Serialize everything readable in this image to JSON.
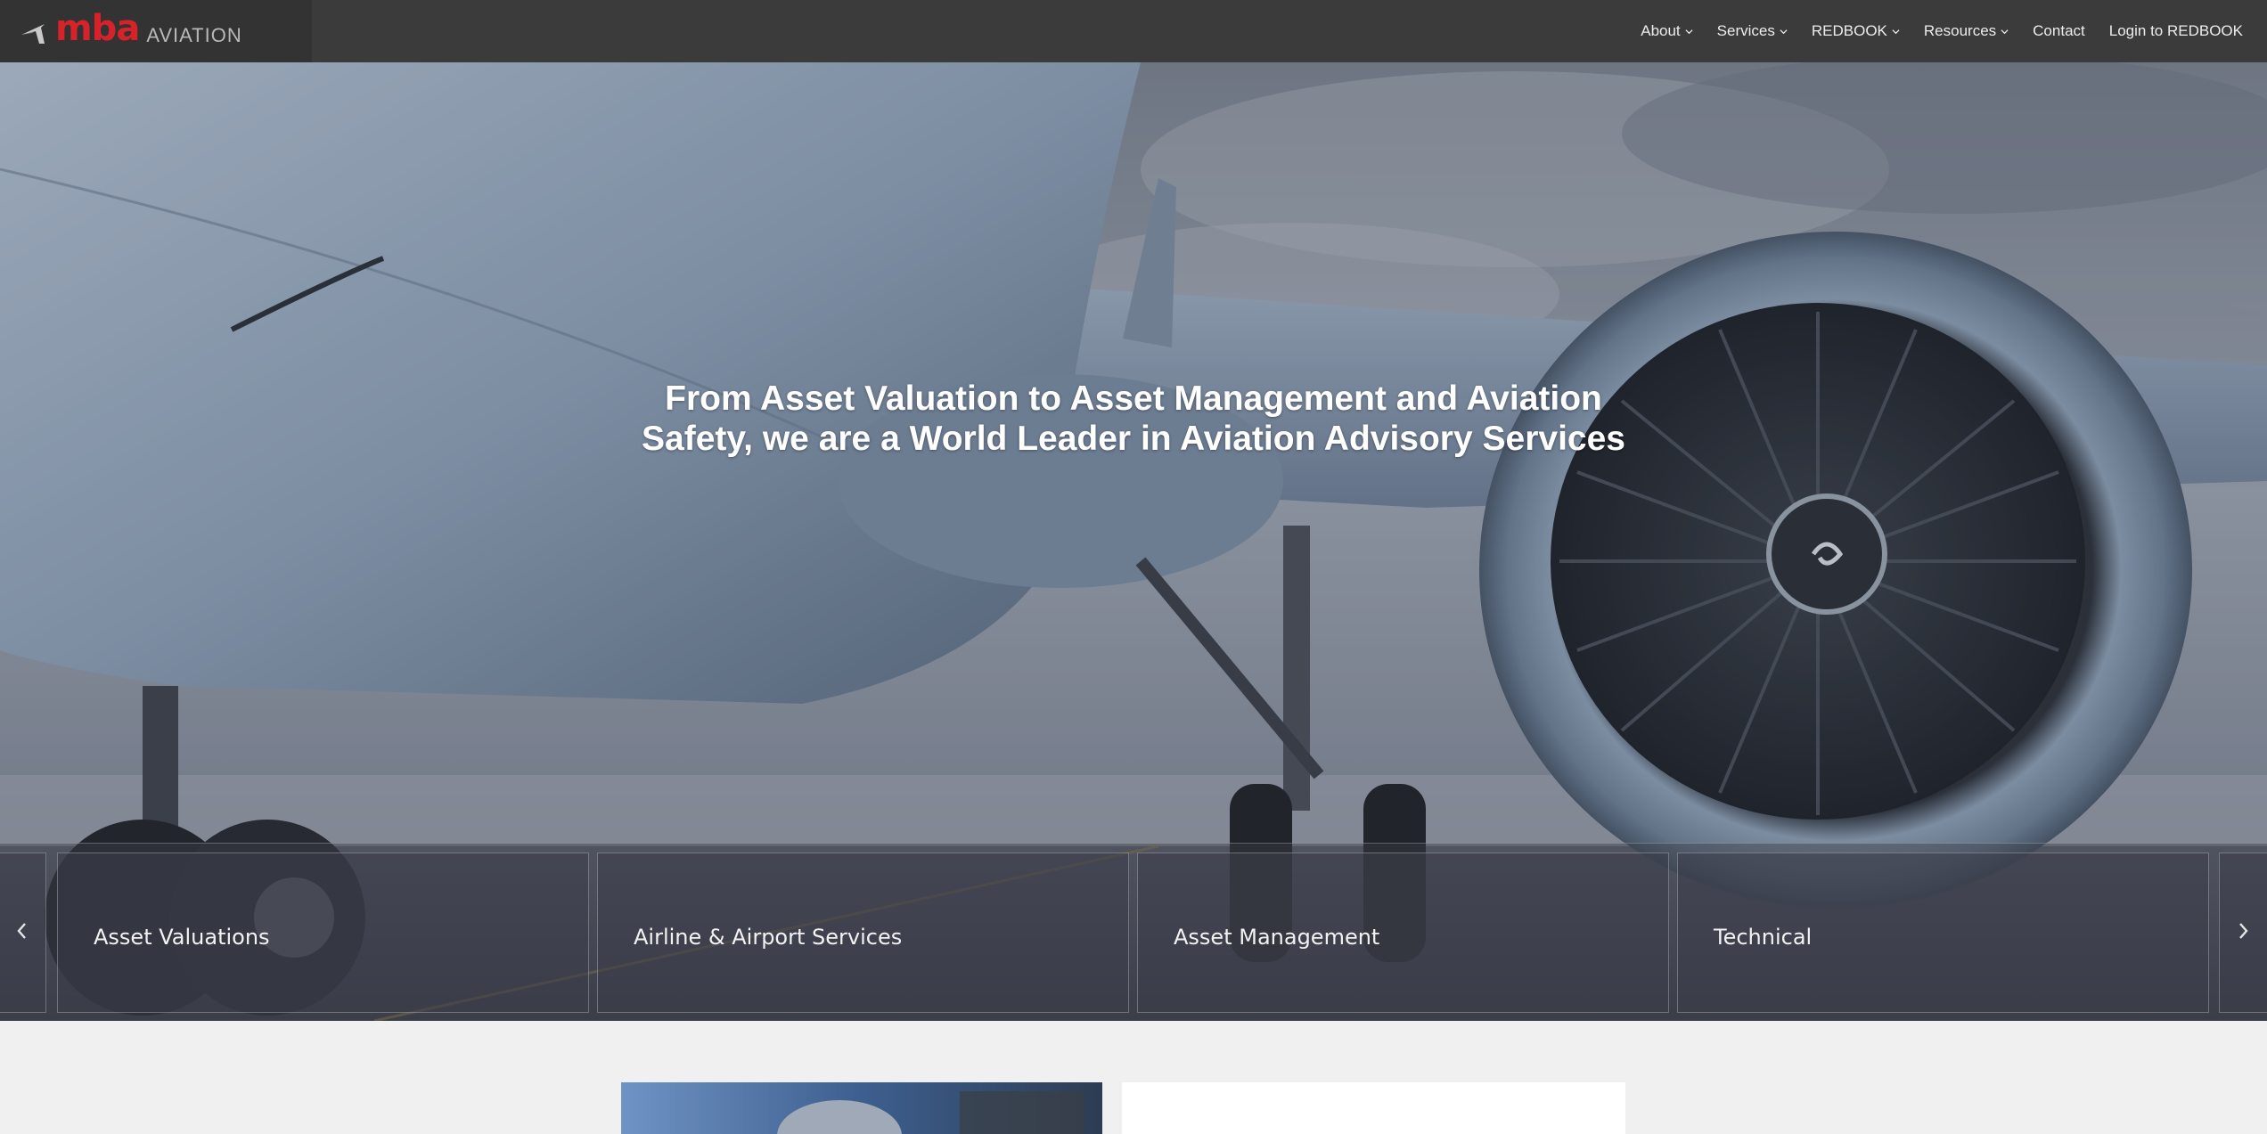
{
  "brand": {
    "logo_wordmark": "mba",
    "logo_subtitle": "AVIATION",
    "accent_color": "#d8222a"
  },
  "nav": {
    "items": [
      {
        "label": "About",
        "has_dropdown": true
      },
      {
        "label": "Services",
        "has_dropdown": true
      },
      {
        "label": "REDBOOK",
        "has_dropdown": true
      },
      {
        "label": "Resources",
        "has_dropdown": true
      },
      {
        "label": "Contact",
        "has_dropdown": false
      },
      {
        "label": "Login to REDBOOK",
        "has_dropdown": false
      }
    ]
  },
  "hero": {
    "title_line1": "From Asset Valuation to Asset Management and Aviation",
    "title_line2": "Safety, we are a World Leader in Aviation Advisory Services"
  },
  "services": {
    "cards": [
      {
        "label": "Asset Valuations"
      },
      {
        "label": "Airline & Airport Services"
      },
      {
        "label": "Asset Management"
      },
      {
        "label": "Technical"
      }
    ],
    "prev_icon": "chevron-left-icon",
    "next_icon": "chevron-right-icon"
  }
}
